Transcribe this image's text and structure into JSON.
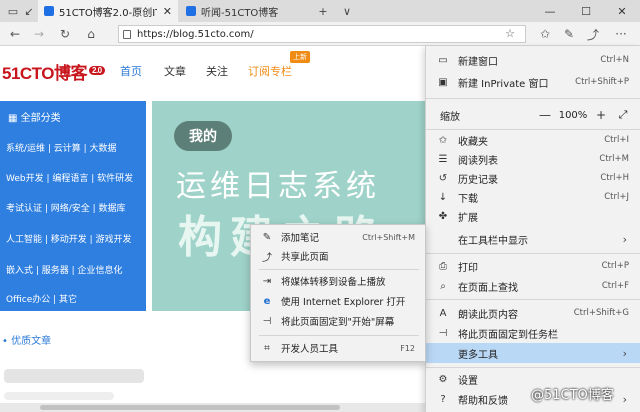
{
  "tabs": [
    {
      "title": "51CTO博客2.0-原创IT技",
      "active": true
    },
    {
      "title": "听闻-51CTO博客",
      "active": false
    }
  ],
  "tabstrip": {
    "new_tab": "+",
    "dropdown": "∨"
  },
  "window": {
    "minimize": "—",
    "maximize": "☐",
    "close": "✕"
  },
  "address": {
    "url": "https://blog.51cto.com/"
  },
  "site": {
    "logo_text": "51CTO博客",
    "logo_version": "2.0",
    "nav": [
      "首页",
      "文章",
      "关注",
      "订阅专栏"
    ],
    "nav_badge": "上新",
    "categories_title": "全部分类",
    "categories": [
      "系统/运维 | 云计算 | 大数据",
      "Web开发 | 编程语言 | 软件研发",
      "考试认证 | 网络/安全 | 数据库",
      "人工智能 | 移动开发 | 游戏开发",
      "嵌入式 | 服务器 | 企业信息化",
      "Office办公 | 其它"
    ],
    "banner": {
      "bubble": "我的",
      "line1": "运维日志系统",
      "line2": "构建之路"
    },
    "good_articles": "• 优质文章"
  },
  "context_menu": {
    "items": [
      {
        "icon": "✎",
        "label": "添加笔记",
        "shortcut": "Ctrl+Shift+M"
      },
      {
        "icon": "⤴",
        "label": "共享此页面",
        "shortcut": ""
      },
      {
        "icon": "⇥",
        "label": "将媒体转移到设备上播放",
        "shortcut": ""
      },
      {
        "icon": "e",
        "label": "使用 Internet Explorer 打开",
        "shortcut": ""
      },
      {
        "icon": "⊣",
        "label": "将此页面固定到\"开始\"屏幕",
        "shortcut": ""
      },
      {
        "icon": "⌗",
        "label": "开发人员工具",
        "shortcut": "F12"
      }
    ]
  },
  "menu": {
    "new_window": {
      "label": "新建窗口",
      "shortcut": "Ctrl+N"
    },
    "new_private": {
      "label": "新建 InPrivate 窗口",
      "shortcut": "Ctrl+Shift+P"
    },
    "zoom": {
      "label": "缩放",
      "minus": "—",
      "value": "100%",
      "plus": "+",
      "full": "⤢"
    },
    "favorites": {
      "label": "收藏夹",
      "shortcut": "Ctrl+I"
    },
    "reading_list": {
      "label": "阅读列表",
      "shortcut": "Ctrl+M"
    },
    "history": {
      "label": "历史记录",
      "shortcut": "Ctrl+H"
    },
    "downloads": {
      "label": "下载",
      "shortcut": "Ctrl+J"
    },
    "extensions": {
      "label": "扩展",
      "shortcut": ""
    },
    "show_in_toolbar": {
      "label": "在工具栏中显示",
      "arrow": "›"
    },
    "print": {
      "label": "打印",
      "shortcut": "Ctrl+P"
    },
    "find": {
      "label": "在页面上查找",
      "shortcut": "Ctrl+F"
    },
    "read_aloud": {
      "label": "朗读此页内容",
      "shortcut": "Ctrl+Shift+G"
    },
    "pin_taskbar": {
      "label": "将此页面固定到任务栏",
      "shortcut": ""
    },
    "more_tools": {
      "label": "更多工具",
      "arrow": "›"
    },
    "settings": {
      "label": "设置",
      "shortcut": ""
    },
    "help": {
      "label": "帮助和反馈",
      "arrow": "›"
    }
  },
  "watermark": "@51CTO博客"
}
